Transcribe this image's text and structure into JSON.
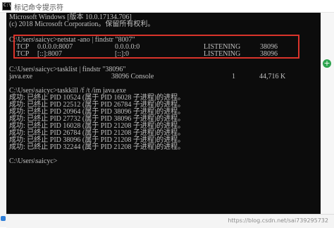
{
  "window": {
    "title": "标记命令提示符",
    "icon_text": "C:\\"
  },
  "console": {
    "banner_line1": "Microsoft Windows [版本 10.0.17134.706]",
    "banner_line2": "(c) 2018 Microsoft Corporation。保留所有权利。",
    "cmd_netstat": "C:\\Users\\saicyc>netstat -ano | findstr \"8007\"",
    "netstat_rows": [
      {
        "proto": "TCP",
        "local": "0.0.0.0:8007",
        "foreign": "0.0.0.0:0",
        "state": "LISTENING",
        "pid": "38096"
      },
      {
        "proto": "TCP",
        "local": "[::]:8007",
        "foreign": "[::]:0",
        "state": "LISTENING",
        "pid": "38096"
      }
    ],
    "cmd_tasklist": "C:\\Users\\saicyc>tasklist | findstr \"38096\"",
    "tasklist_row": {
      "image": "java.exe",
      "pid_session": "38096 Console",
      "num": "1",
      "mem": "44,716 K"
    },
    "cmd_taskkill": "C:\\Users\\saicyc>taskkill /f /t /im java.exe",
    "kill_lines": [
      "成功: 已终止 PID 10524 (属于 PID 16028 子进程)的进程。",
      "成功: 已终止 PID 22512 (属于 PID 26784 子进程)的进程。",
      "成功: 已终止 PID 20964 (属于 PID 38096 子进程)的进程。",
      "成功: 已终止 PID 27732 (属于 PID 38096 子进程)的进程。",
      "成功: 已终止 PID 16028 (属于 PID 21208 子进程)的进程。",
      "成功: 已终止 PID 26784 (属于 PID 21208 子进程)的进程。",
      "成功: 已终止 PID 38096 (属于 PID 21208 子进程)的进程。",
      "成功: 已终止 PID 32244 (属于 PID 21208 子进程)的进程。"
    ],
    "final_prompt": "C:\\Users\\saicyc>"
  },
  "statusbar": {
    "watermark": "https://blog.csdn.net/sai739295732"
  },
  "colors": {
    "console_bg": "#0c0c0c",
    "console_text": "#c0c0c0",
    "highlight": "#d9342b"
  }
}
